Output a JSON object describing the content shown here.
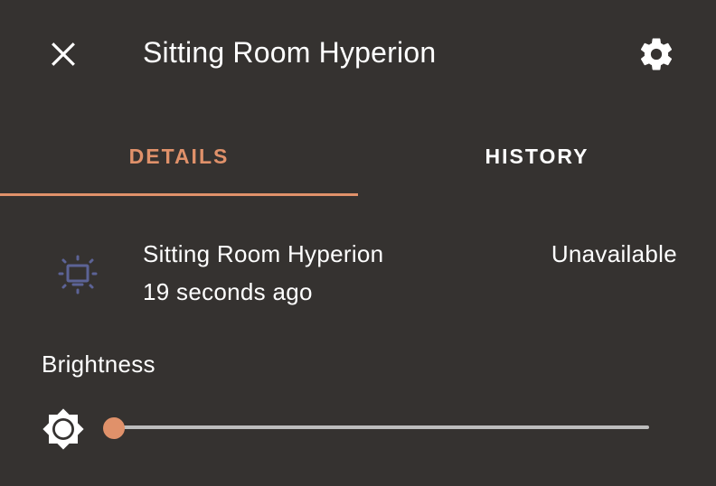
{
  "dialog": {
    "title": "Sitting Room Hyperion",
    "close_icon": "close-icon",
    "settings_icon": "gear-icon"
  },
  "tabs": [
    {
      "label": "DETAILS",
      "active": true
    },
    {
      "label": "HISTORY",
      "active": false
    }
  ],
  "entity": {
    "icon": "television-ambient-light-icon",
    "name": "Sitting Room Hyperion",
    "last_changed": "19 seconds ago",
    "state": "Unavailable"
  },
  "brightness": {
    "label": "Brightness",
    "icon": "brightness-icon",
    "value_fraction": 0
  },
  "colors": {
    "background": "#353230",
    "accent": "#e0916a",
    "icon_muted": "#5c6396",
    "track": "#bdbdbd"
  }
}
